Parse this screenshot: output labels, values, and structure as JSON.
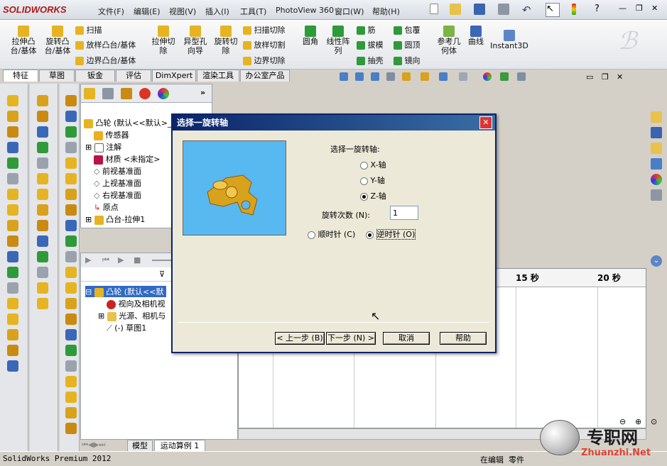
{
  "app": {
    "logo": "SOLIDWORKS",
    "version_status": "SolidWorks Premium 2012"
  },
  "menu": [
    "文件(F)",
    "编辑(E)",
    "视图(V)",
    "插入(I)",
    "工具(T)",
    "PhotoView 360",
    "窗口(W)",
    "帮助(H)"
  ],
  "ribbon": {
    "big": [
      "拉伸凸\n台/基体",
      "旋转凸\n台/基体",
      "拉伸切\n除",
      "异型孔\n向导",
      "旋转切\n除",
      "圆角",
      "线性阵\n列",
      "参考几\n何体",
      "曲线",
      "Instant3D"
    ],
    "small": [
      "扫描",
      "放样凸台/基体",
      "边界凸台/基体",
      "扫描切除",
      "放样切割",
      "边界切除",
      "筋",
      "拔模",
      "抽壳",
      "包覆",
      "圆顶",
      "镜向"
    ]
  },
  "tabs": [
    "特征",
    "草图",
    "钣金",
    "评估",
    "DimXpert",
    "渲染工具",
    "办公室产品"
  ],
  "tree": {
    "root": "凸轮  (默认<<默认>_",
    "items": [
      "传感器",
      "注解",
      "材质 <未指定>",
      "前视基准面",
      "上视基准面",
      "右视基准面",
      "原点",
      "凸台-拉伸1"
    ]
  },
  "motion_tree": {
    "root": "凸轮  (默认<<默",
    "items": [
      "视向及相机视",
      "光源、相机与",
      "(-) 草图1"
    ]
  },
  "timeline": {
    "ticks": [
      "15 秒",
      "20 秒"
    ]
  },
  "bottom_tabs": [
    "模型",
    "运动算例 1"
  ],
  "status": {
    "mode": "在编辑",
    "doc": "零件"
  },
  "watermark": {
    "site": "专职网",
    "url": "Zhuanzhi.Net"
  },
  "dialog": {
    "title": "选择一旋转轴",
    "prompt": "选择一旋转轴:",
    "axes": [
      "X-轴",
      "Y-轴",
      "Z-轴"
    ],
    "selected_axis": "Z-轴",
    "count_label": "旋转次数 (N):",
    "count_value": "1",
    "direction": [
      "顺时针 (C)",
      "逆时针 (O)"
    ],
    "selected_direction": "逆时针 (O)",
    "buttons": [
      "< 上一步 (B)",
      "下一步 (N) >",
      "取消",
      "帮助"
    ]
  },
  "colors": {
    "accent": "#0a246a",
    "preview_bg": "#58b8f0",
    "part": "#d9a21c"
  }
}
